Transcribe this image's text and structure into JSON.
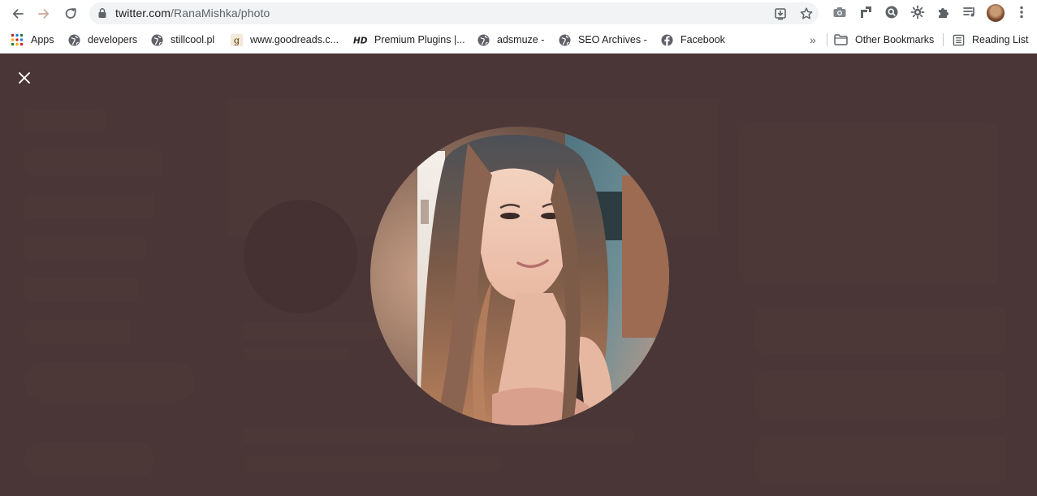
{
  "browser": {
    "url_host": "twitter.com",
    "url_path": "/RanaMishka/photo"
  },
  "bookmarks": {
    "items": [
      {
        "label": "Apps",
        "icon": "apps-grid-icon"
      },
      {
        "label": "developers",
        "icon": "globe-icon"
      },
      {
        "label": "stillcool.pl",
        "icon": "globe-icon"
      },
      {
        "label": "www.goodreads.c...",
        "icon": "goodreads-icon"
      },
      {
        "label": "Premium Plugins |...",
        "icon": "hd-icon"
      },
      {
        "label": "adsmuze -",
        "icon": "globe-icon"
      },
      {
        "label": "SEO Archives -",
        "icon": "globe-icon"
      },
      {
        "label": "Facebook",
        "icon": "facebook-icon"
      }
    ],
    "overflow": "»",
    "other": "Other Bookmarks",
    "reading_list": "Reading List"
  },
  "colors": {
    "backdrop": "#4a3636",
    "toolbar": "#ffffff",
    "omnibox": "#f1f3f4"
  }
}
